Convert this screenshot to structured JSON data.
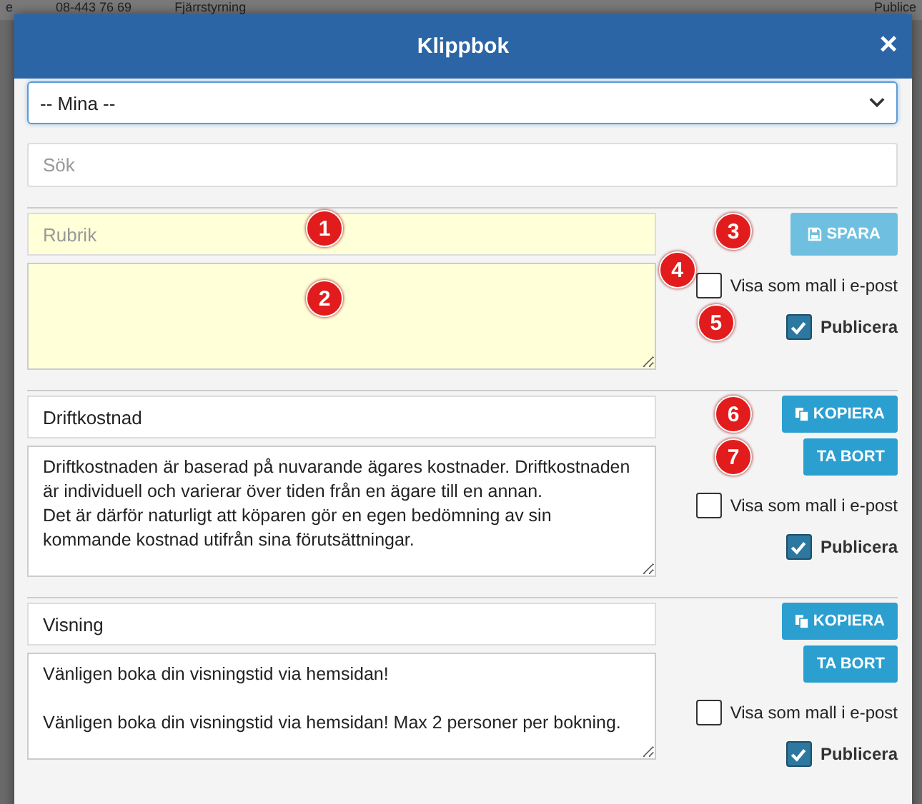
{
  "backdrop": {
    "texts": [
      "e",
      "08-443 76 69",
      "Fjärrstyrning",
      "Publice"
    ]
  },
  "window": {
    "title": "Klippbok",
    "close": "×"
  },
  "filter": {
    "value": "-- Mina --"
  },
  "search": {
    "placeholder": "Sök"
  },
  "entries": [
    {
      "kind": "new",
      "title": {
        "placeholder": "Rubrik"
      },
      "buttons": [
        {
          "kind": "save",
          "label": "SPARA",
          "disabled": true,
          "marker": "3"
        }
      ],
      "template": {
        "label": "Visa som mall i e-post",
        "checked": false,
        "marker": "4"
      },
      "publish": {
        "label": "Publicera",
        "checked": true,
        "marker": "5"
      },
      "title_marker": "1",
      "body_marker": "2"
    },
    {
      "kind": "saved",
      "title": {
        "value": "Driftkostnad"
      },
      "body": {
        "value": "Driftkostnaden är baserad på nuvarande ägares kostnader. Driftkostnaden är individuell och varierar över tiden från en ägare till en annan.\nDet är därför naturligt att köparen gör en egen bedömning av sin kommande kostnad utifrån sina förutsättningar."
      },
      "buttons": [
        {
          "kind": "copy",
          "label": "KOPIERA",
          "disabled": false,
          "marker": "6"
        },
        {
          "kind": "delete",
          "label": "TA BORT",
          "disabled": false,
          "marker": "7"
        }
      ],
      "template": {
        "label": "Visa som mall i e-post",
        "checked": false
      },
      "publish": {
        "label": "Publicera",
        "checked": true
      }
    },
    {
      "kind": "saved",
      "title": {
        "value": "Visning"
      },
      "body": {
        "value": "Vänligen boka din visningstid via hemsidan!\n\nVänligen boka din visningstid via hemsidan! Max 2 personer per bokning."
      },
      "buttons": [
        {
          "kind": "copy",
          "label": "KOPIERA",
          "disabled": false
        },
        {
          "kind": "delete",
          "label": "TA BORT",
          "disabled": false
        }
      ],
      "template": {
        "label": "Visa som mall i e-post",
        "checked": false
      },
      "publish": {
        "label": "Publicera",
        "checked": true
      }
    }
  ]
}
